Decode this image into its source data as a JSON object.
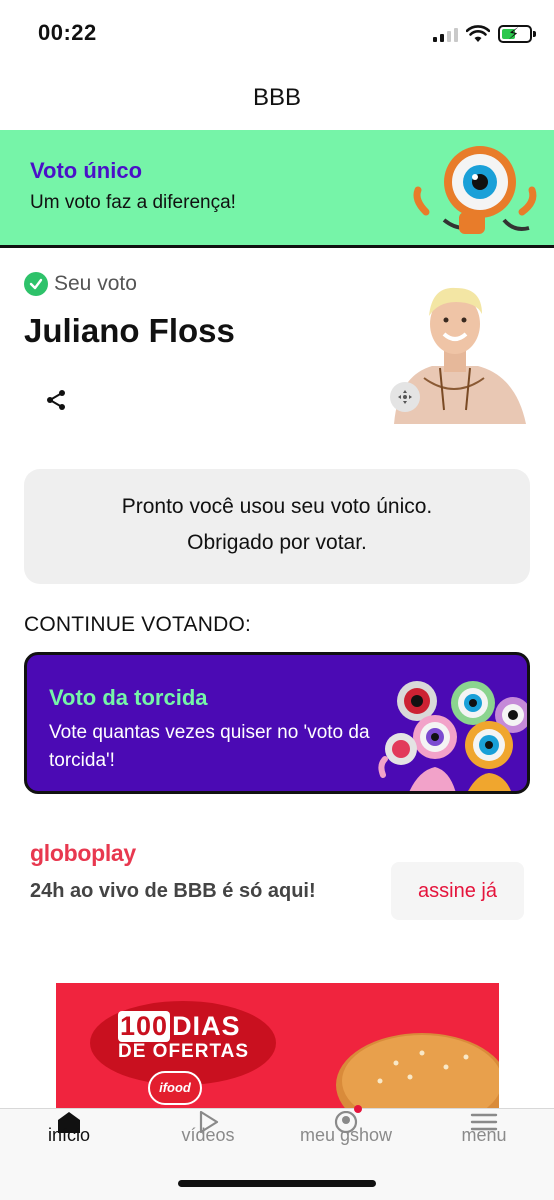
{
  "status_bar": {
    "time": "00:22"
  },
  "header": {
    "title": "BBB"
  },
  "banner_unico": {
    "title": "Voto único",
    "subtitle": "Um voto faz a diferença!"
  },
  "vote": {
    "label": "Seu voto",
    "candidate": "Juliano Floss"
  },
  "info": {
    "line1": "Pronto você usou seu voto único.",
    "line2": "Obrigado por votar."
  },
  "continue_heading": "CONTINUE VOTANDO:",
  "torcida": {
    "title": "Voto da torcida",
    "description": "Vote quantas vezes quiser no 'voto da torcida'!"
  },
  "globoplay": {
    "logo": "globoplay",
    "text": "24h ao vivo de BBB é só aqui!",
    "button": "assine já"
  },
  "ad": {
    "number": "100",
    "line1": "DIAS",
    "line2": "DE OFERTAS",
    "brand": "ifood"
  },
  "tabs": [
    {
      "label": "início",
      "icon": "home-icon",
      "active": true
    },
    {
      "label": "vídeos",
      "icon": "play-icon",
      "active": false
    },
    {
      "label": "meu gshow",
      "icon": "profile-icon",
      "active": false
    },
    {
      "label": "menu",
      "icon": "hamburger-icon",
      "active": false
    }
  ],
  "colors": {
    "banner_green": "#76f4a8",
    "accent_purple": "#4b0ab4",
    "globoplay_red": "#e8384f",
    "check_green": "#2ec26a"
  }
}
